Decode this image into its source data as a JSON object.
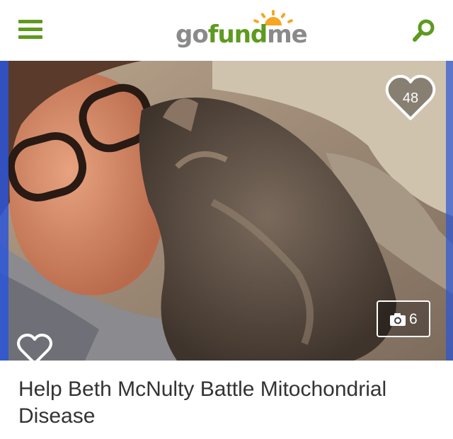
{
  "colors": {
    "brand_green": "#5d9a1e",
    "logo_gray": "#8a8a8a",
    "sun_orange": "#f5a623"
  },
  "header": {
    "logo": {
      "go": "go",
      "fund": "fund",
      "me": "me"
    },
    "icons": {
      "menu": "hamburger-menu-icon",
      "search": "search-icon"
    }
  },
  "campaign": {
    "hearts_count": "48",
    "photo_count": "6",
    "title": "Help Beth McNulty Battle Mitochondrial Disease"
  }
}
